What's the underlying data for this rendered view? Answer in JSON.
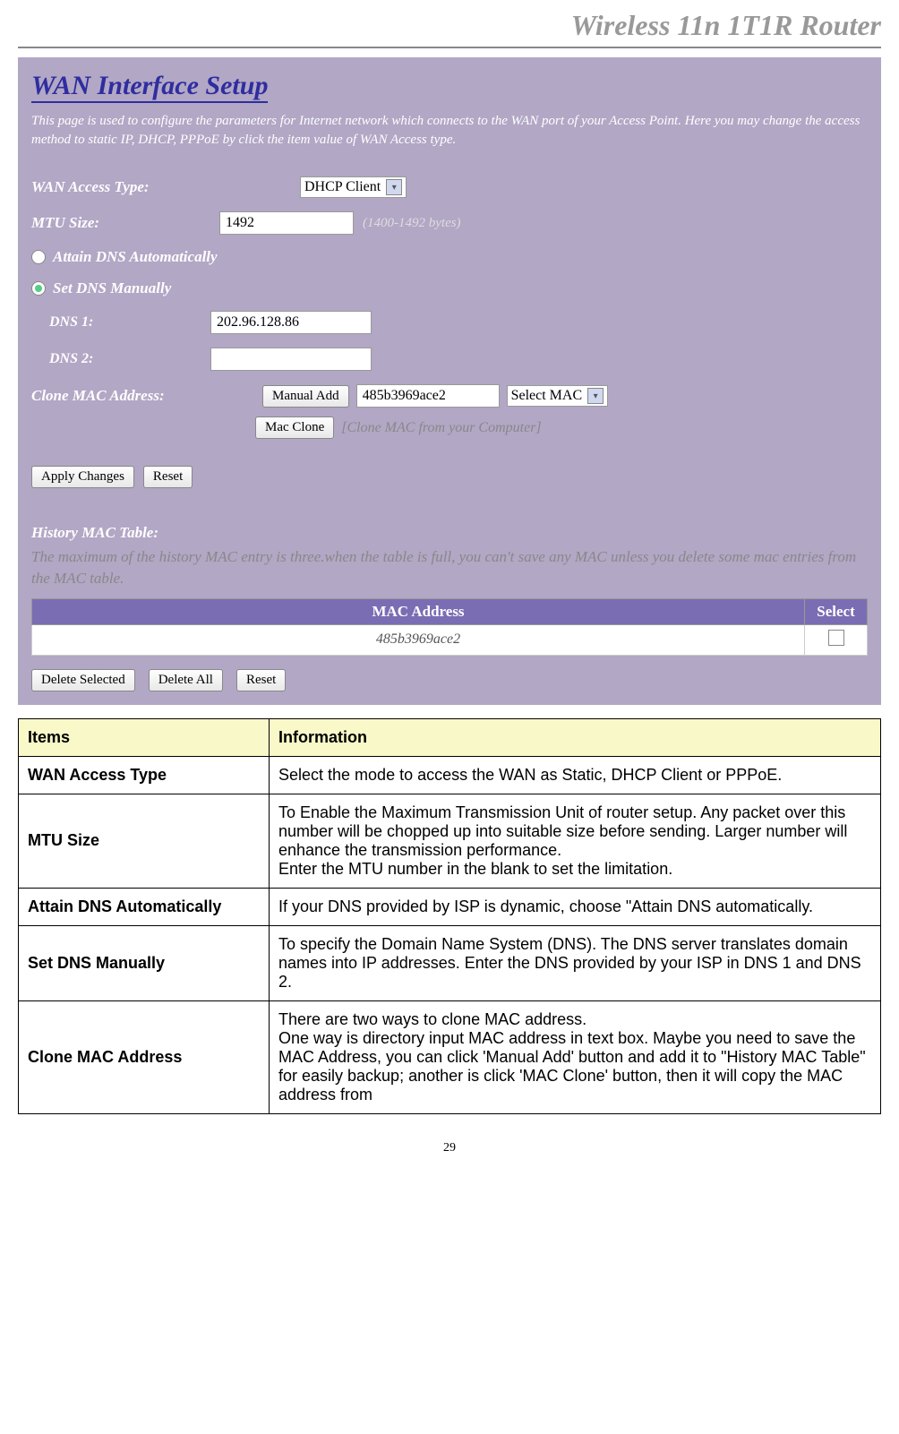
{
  "header": {
    "title": "Wireless 11n 1T1R Router"
  },
  "panel": {
    "title": "WAN Interface Setup",
    "desc": "This page is used to configure the parameters for Internet network which connects to the WAN port of your Access Point. Here you may change the access method to static IP, DHCP, PPPoE by click the item value of WAN Access type.",
    "wan_type_label": "WAN Access Type:",
    "wan_type_value": "DHCP Client",
    "mtu_label": "MTU Size:",
    "mtu_value": "1492",
    "mtu_note": "(1400-1492 bytes)",
    "radio1": "Attain DNS Automatically",
    "radio2": "Set DNS Manually",
    "dns1_label": "DNS 1:",
    "dns1_value": "202.96.128.86",
    "dns2_label": "DNS 2:",
    "dns2_value": "",
    "clone_label": "Clone MAC Address:",
    "manual_add_btn": "Manual Add",
    "mac_input": "485b3969ace2",
    "select_mac": "Select MAC",
    "mac_clone_btn": "Mac Clone",
    "mac_clone_note": "[Clone MAC from your Computer]",
    "apply_btn": "Apply Changes",
    "reset_btn": "Reset",
    "history_title": "History MAC Table:",
    "history_desc": "The maximum of the history MAC entry is three.when the table is full, you can't save any MAC unless you delete some mac entries from the MAC table.",
    "th_mac": "MAC Address",
    "th_select": "Select",
    "row_mac": "485b3969ace2",
    "delete_selected_btn": "Delete Selected",
    "delete_all_btn": "Delete All",
    "reset2_btn": "Reset"
  },
  "table": {
    "h1": "Items",
    "h2": "Information",
    "rows": [
      {
        "item": "WAN Access Type",
        "info": "Select the mode to access the WAN as Static, DHCP Client or PPPoE."
      },
      {
        "item": "MTU Size",
        "info": "To Enable the Maximum Transmission Unit of router setup. Any packet over this number will be chopped up into suitable size before sending. Larger number will enhance the transmission performance.\nEnter the MTU number in the blank to set the limitation."
      },
      {
        "item": "Attain DNS Automatically",
        "info": "If your DNS provided by ISP is dynamic, choose \"Attain DNS automatically."
      },
      {
        "item": "Set DNS Manually",
        "info": "To specify the Domain Name System (DNS). The DNS server translates domain names into IP addresses. Enter the DNS provided by your ISP in DNS 1 and DNS 2."
      },
      {
        "item": "Clone MAC Address",
        "info": "There are two ways to clone MAC address.\nOne way is directory input MAC address in text box. Maybe you need to save the MAC Address, you can click 'Manual Add' button and add it to \"History MAC Table\" for easily backup; another is click 'MAC Clone' button, then it will copy the MAC address from"
      }
    ]
  },
  "pagenum": "29"
}
